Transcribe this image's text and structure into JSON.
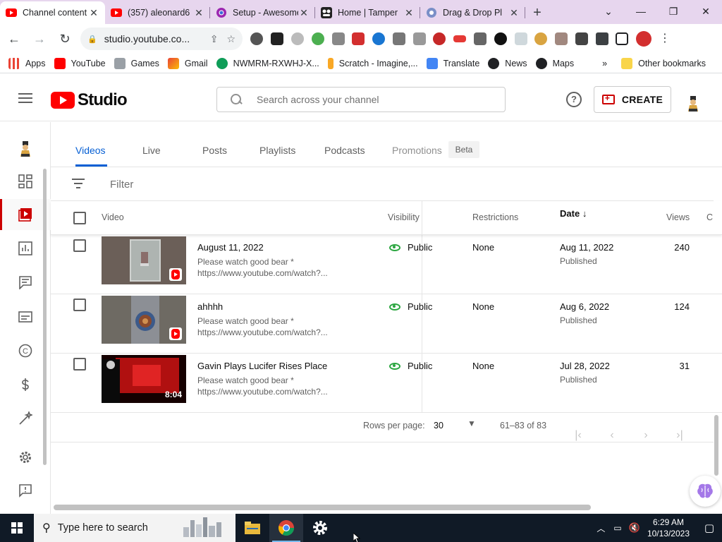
{
  "browser": {
    "tabs": [
      {
        "title": "Channel content",
        "favicon": "youtube-icon"
      },
      {
        "title": "(357) aleonard6",
        "favicon": "youtube-icon"
      },
      {
        "title": "Setup - Awesome",
        "favicon": "chrome-icon"
      },
      {
        "title": "Home | Tamper",
        "favicon": "tampermonkey-icon"
      },
      {
        "title": "Drag & Drop Pl",
        "favicon": "globe-icon"
      }
    ],
    "url": "studio.youtube.co...",
    "bookmarks": [
      {
        "label": "Apps"
      },
      {
        "label": "YouTube"
      },
      {
        "label": "Games"
      },
      {
        "label": "Gmail"
      },
      {
        "label": "NWMRM-RXWHJ-X..."
      },
      {
        "label": "Scratch - Imagine,..."
      },
      {
        "label": "Translate"
      },
      {
        "label": "News"
      },
      {
        "label": "Maps"
      }
    ],
    "bookmarks_more": "»",
    "other_bookmarks": "Other bookmarks"
  },
  "studio": {
    "logo_text": "Studio",
    "search_placeholder": "Search across your channel",
    "create_label": "CREATE"
  },
  "content_tabs": [
    {
      "label": "Videos"
    },
    {
      "label": "Live"
    },
    {
      "label": "Posts"
    },
    {
      "label": "Playlists"
    },
    {
      "label": "Podcasts"
    },
    {
      "label": "Promotions"
    }
  ],
  "beta_badge": "Beta",
  "filter_placeholder": "Filter",
  "table": {
    "headers": {
      "video": "Video",
      "visibility": "Visibility",
      "restrictions": "Restrictions",
      "date": "Date",
      "views": "Views",
      "comments_partial": "C"
    },
    "rows": [
      {
        "title": "August 11, 2022",
        "desc1": "Please watch good bear *",
        "desc2": "https://www.youtube.com/watch?...",
        "visibility": "Public",
        "restrictions": "None",
        "date": "Aug 11, 2022",
        "date_status": "Published",
        "views": "240",
        "duration": ""
      },
      {
        "title": "ahhhh",
        "desc1": "Please watch good bear *",
        "desc2": "https://www.youtube.com/watch?...",
        "visibility": "Public",
        "restrictions": "None",
        "date": "Aug 6, 2022",
        "date_status": "Published",
        "views": "124",
        "duration": ""
      },
      {
        "title": "Gavin Plays Lucifer Rises Place",
        "desc1": "Please watch good bear *",
        "desc2": "https://www.youtube.com/watch?...",
        "visibility": "Public",
        "restrictions": "None",
        "date": "Jul 28, 2022",
        "date_status": "Published",
        "views": "31",
        "duration": "8:04"
      }
    ]
  },
  "pagination": {
    "rows_per_page_label": "Rows per page:",
    "rows_per_page_value": "30",
    "range": "61–83 of 83"
  },
  "taskbar": {
    "search_placeholder": "Type here to search",
    "time": "6:29 AM",
    "date": "10/13/2023"
  }
}
